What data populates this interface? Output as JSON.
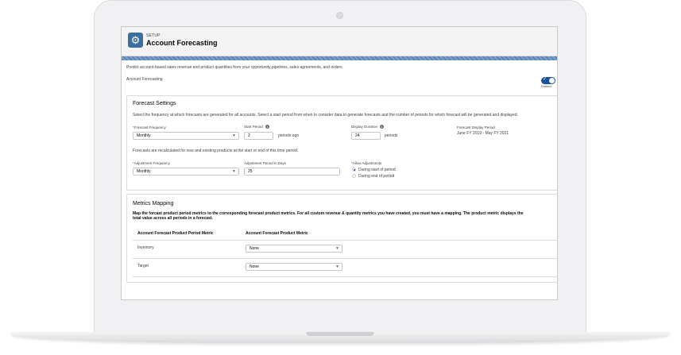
{
  "header": {
    "setup_label": "SETUP",
    "title": "Account Forecasting",
    "icon": "gear-icon"
  },
  "description": "Predict account-based sales revenue and product quantities from your opportunity pipelines, sales agreements, and orders.",
  "account_forecasting": {
    "label": "Account Forecasting",
    "toggle_status": "Enabled"
  },
  "forecast_settings": {
    "title": "Forecast Settings",
    "intro": "Select the frequency at which forecasts are generated for all accounts. Select a start period from when to consider data to generate forecasts and the number of periods for which forecast will be generated and displayed.",
    "frequency_label": "Forecast Frequency",
    "frequency_value": "Monthly",
    "start_period_label": "Start Period",
    "start_period_value": "2",
    "start_period_suffix": "periods ago",
    "display_duration_label": "Display Duration",
    "display_duration_value": "24",
    "display_duration_suffix": "periods",
    "display_period_label": "Forecast Display Period",
    "display_period_value": "June FY 2019 - May FY 2021",
    "recalc_note": "Forecasts are recalculated for new and existing products at the start or end of this time period.",
    "adjustment_frequency_label": "Adjustment Frequency",
    "adjustment_frequency_value": "Monthly",
    "adjustment_days_label": "Adjustment Period in Days",
    "adjustment_days_value": "25",
    "allow_adjustments_label": "Allow Adjustments",
    "option_start": "During start of period",
    "option_end": "During end of period"
  },
  "metrics_mapping": {
    "title": "Metrics Mapping",
    "intro_line1": "Map the forcast product period metrics to the corresponding forecast product metrics. For all custom revenue & quantity metrics you have created, you must have a mapping. The product metric displays the",
    "intro_line2": "total value across all periods in a forecast.",
    "col1": "Account Forecast Product Period Metric",
    "col2": "Account Forecast Product Metric",
    "rows": [
      {
        "metric": "Inventory",
        "value": "None"
      },
      {
        "metric": "Target",
        "value": "None"
      }
    ]
  },
  "colors": {
    "brand": "#1b5297",
    "header_icon": "#3b6fa0"
  }
}
